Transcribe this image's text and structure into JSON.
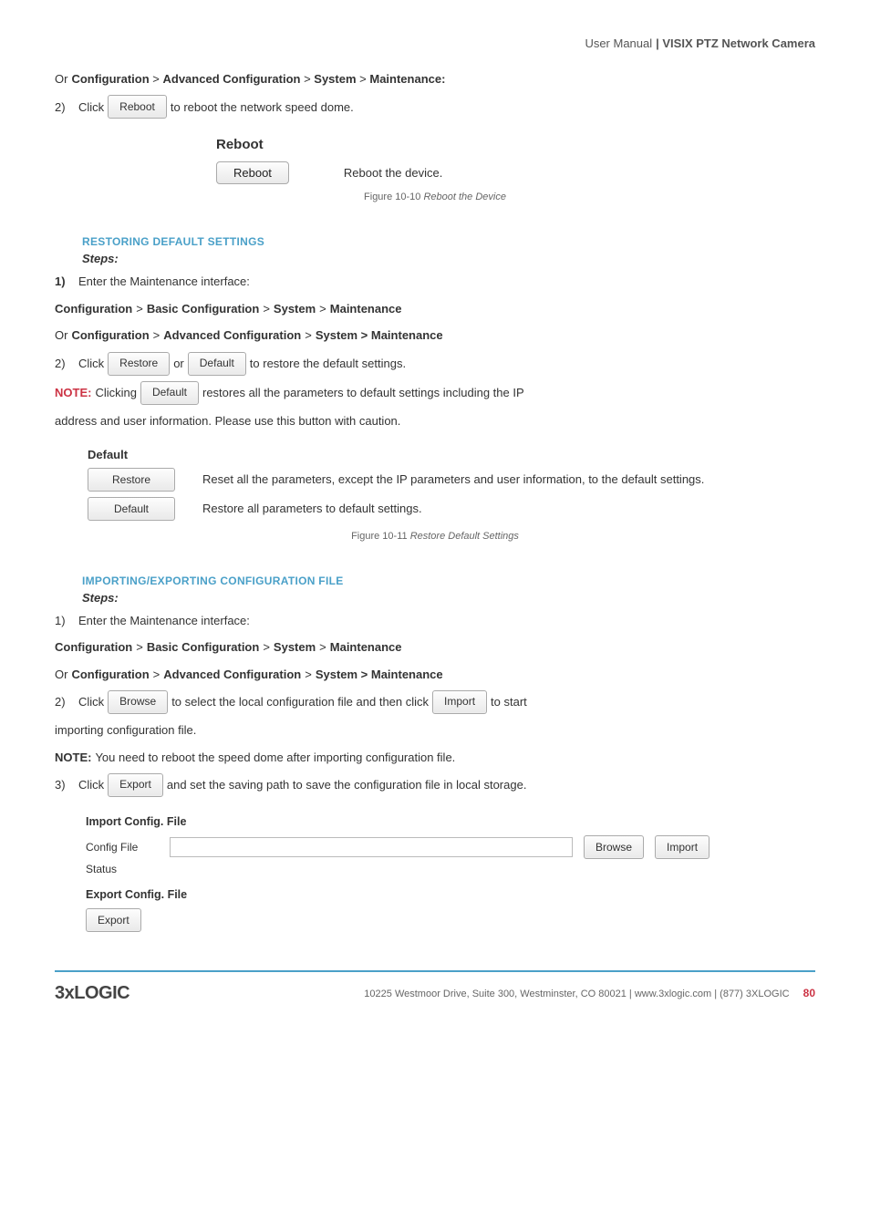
{
  "header": {
    "light": "User Manual",
    "bold": "| VISIX PTZ Network Camera"
  },
  "reboot_section": {
    "or_line_prefix": "Or ",
    "or_path": [
      "Configuration",
      "Advanced Configuration",
      "System",
      "Maintenance:"
    ],
    "step2_num": "2)",
    "step2_a": "Click",
    "btn_reboot": "Reboot",
    "step2_b": "to reboot the network speed dome.",
    "panel_title": "Reboot",
    "panel_btn": "Reboot",
    "panel_text": "Reboot the device.",
    "fig": "Figure 10-10",
    "fig_ital": "Reboot the Device"
  },
  "restore_section": {
    "heading": "RESTORING DEFAULT SETTINGS",
    "steps": "Steps:",
    "s1_num": "1)",
    "s1_text": "Enter the Maintenance interface:",
    "path1": [
      "Configuration",
      "Basic Configuration",
      "System",
      "Maintenance"
    ],
    "or": "Or ",
    "path2": [
      "Configuration",
      "Advanced Configuration",
      "System > Maintenance"
    ],
    "s2_num": "2)",
    "s2_a": "Click",
    "btn_restore": "Restore",
    "s2_or": "or",
    "btn_default": "Default",
    "s2_b": "to restore the default settings.",
    "note_label": "NOTE:",
    "note_a": "Clicking",
    "note_btn": "Default",
    "note_b": "restores all the parameters to default settings including the IP",
    "note_c": "address and user information. Please use this button with caution.",
    "panel_header": "Default",
    "row1_btn": "Restore",
    "row1_text": "Reset all the parameters, except the IP parameters and user information, to the default settings.",
    "row2_btn": "Default",
    "row2_text": "Restore all parameters to default settings.",
    "fig": "Figure 10-11",
    "fig_ital": "Restore Default Settings"
  },
  "import_section": {
    "heading": "IMPORTING/EXPORTING CONFIGURATION FILE",
    "steps": "Steps:",
    "s1_num": "1)",
    "s1_text": "Enter the Maintenance interface:",
    "path1": [
      "Configuration",
      "Basic Configuration",
      "System",
      "Maintenance"
    ],
    "or": "Or ",
    "path2": [
      "Configuration",
      "Advanced Configuration",
      "System > Maintenance"
    ],
    "s2_num": "2)",
    "s2_a": "Click",
    "btn_browse": "Browse",
    "s2_b": "to select the local configuration file and then click",
    "btn_import": "Import",
    "s2_c": "to start",
    "s2_d": "importing configuration file.",
    "note_label": "NOTE:",
    "note_text": "You need to reboot the speed dome after importing configuration file.",
    "s3_num": "3)",
    "s3_a": "Click",
    "btn_export": "Export",
    "s3_b": "and set the saving path to save the configuration file in local storage.",
    "panel_import_header": "Import Config. File",
    "config_file_label": "Config File",
    "browse2": "Browse",
    "import2": "Import",
    "status_label": "Status",
    "panel_export_header": "Export Config. File",
    "export2": "Export"
  },
  "footer": {
    "logo": "3xLOGIC",
    "addr": "10225 Westmoor Drive, Suite 300, Westminster, CO 80021 | www.3xlogic.com | (877) 3XLOGIC",
    "page": "80"
  },
  "sep": " > "
}
